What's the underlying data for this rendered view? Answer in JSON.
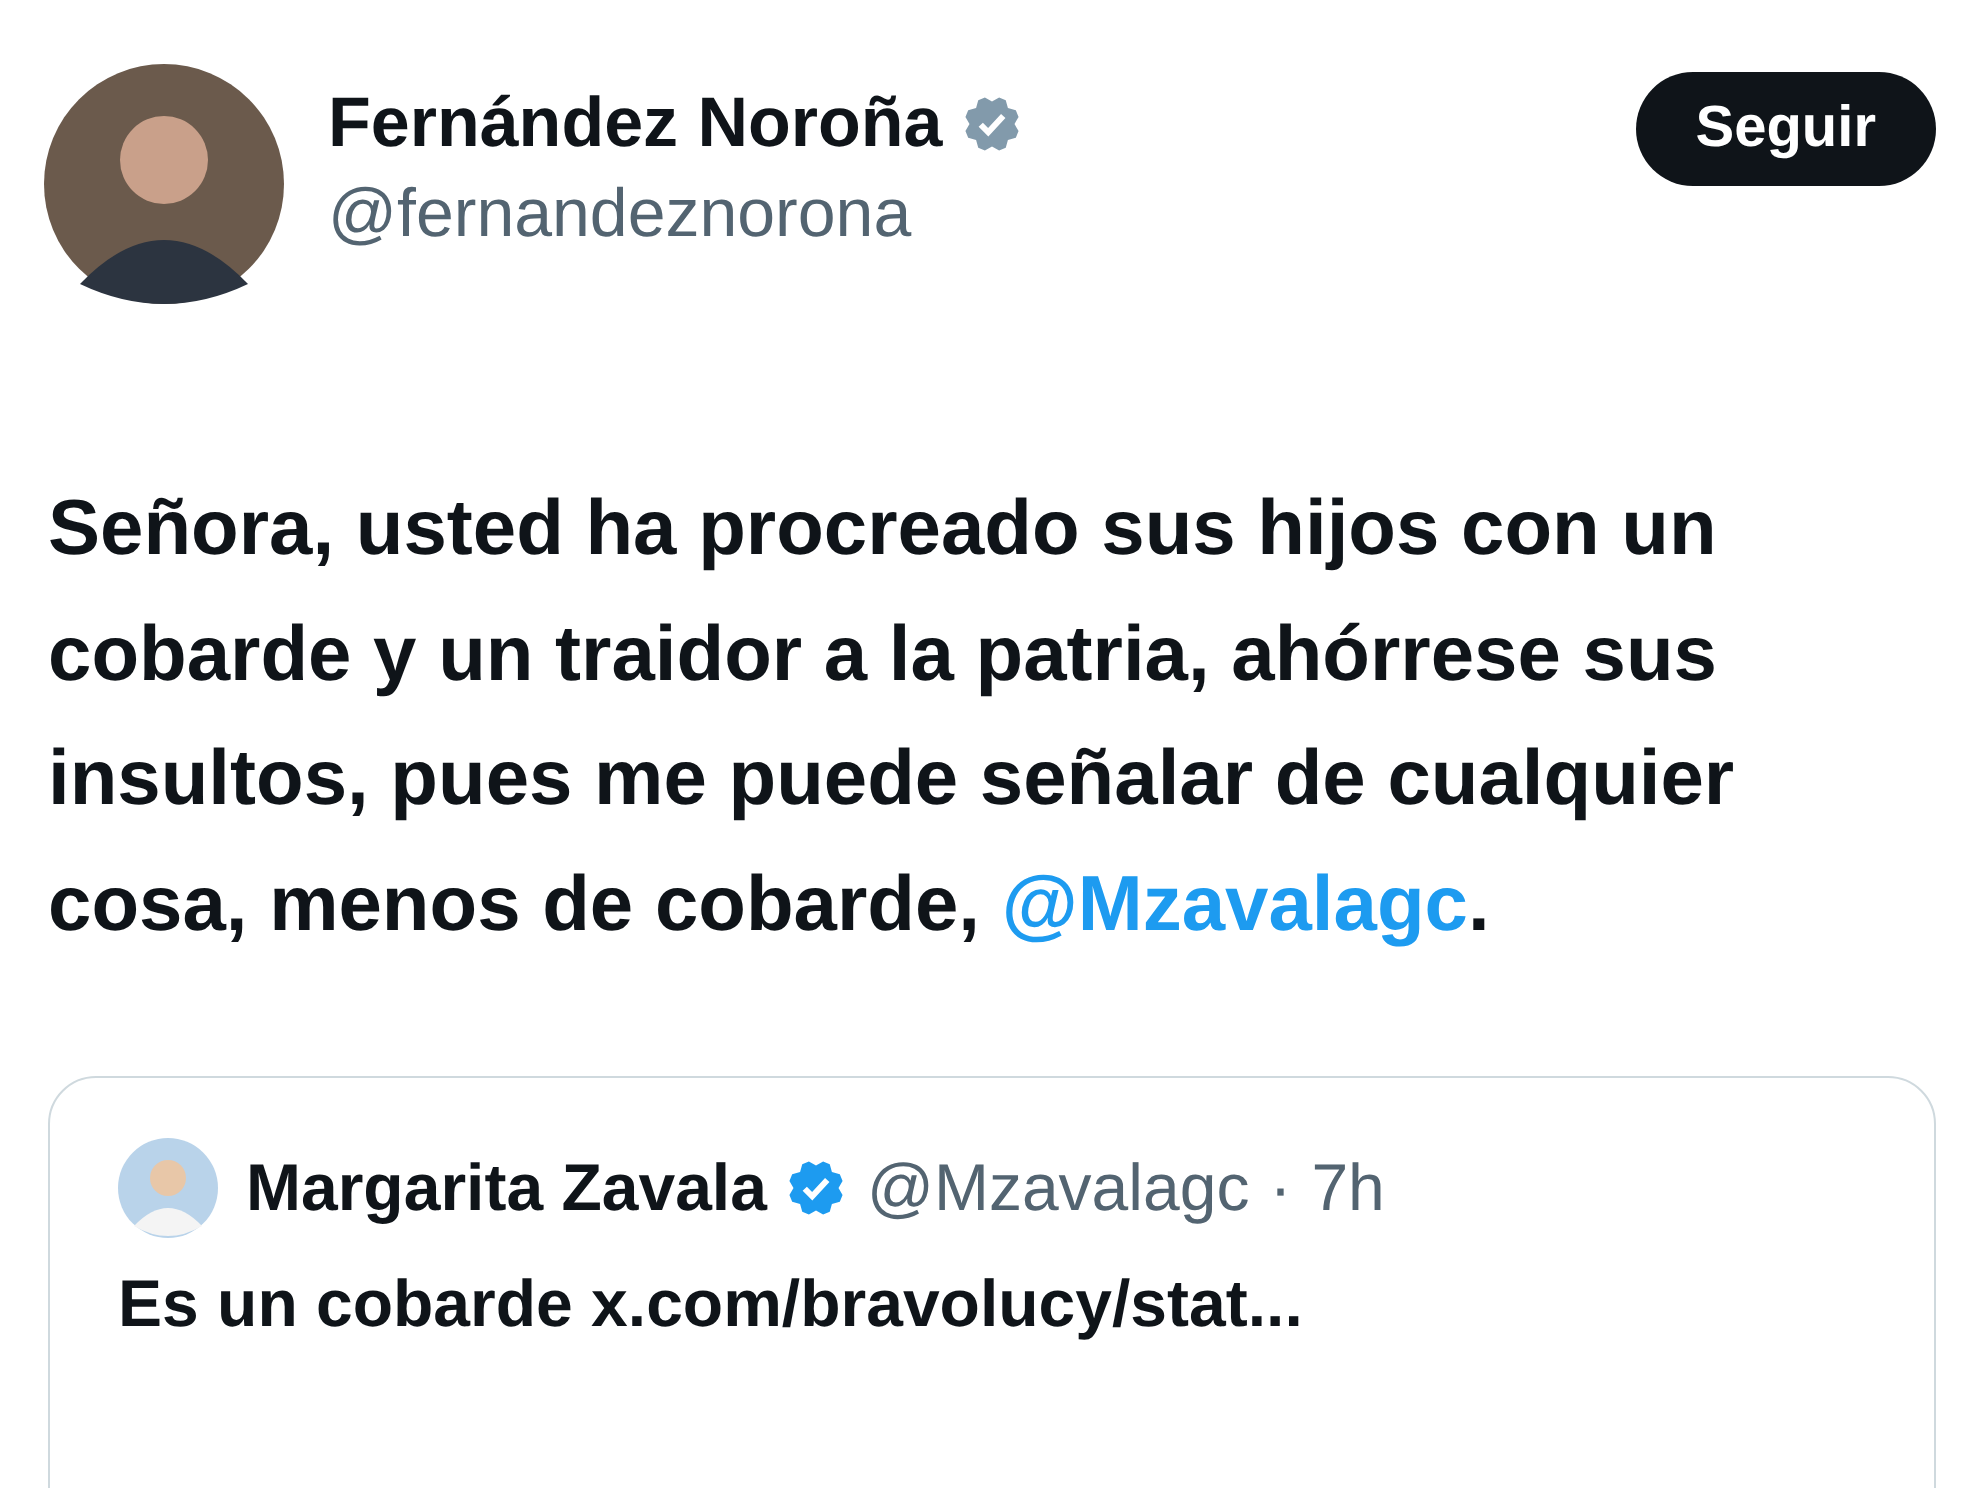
{
  "author": {
    "name": "Fernández Noroña",
    "handle": "@fernandeznorona",
    "verified": true,
    "badge": {
      "color": "#829aab"
    }
  },
  "follow_button": {
    "label": "Seguir"
  },
  "tweet_text": [
    {
      "kind": "text",
      "text": "Señora, usted ha procreado sus hijos con un cobarde y un traidor a la patria, ahórrese sus insultos, pues me puede señalar de cualquier cosa, menos de cobarde, "
    },
    {
      "kind": "mention",
      "text": "@Mzavalagc"
    },
    {
      "kind": "text",
      "text": "."
    }
  ],
  "quoted_tweet": {
    "name": "Margarita Zavala",
    "verified": true,
    "badge": {
      "color": "#1d9bf0"
    },
    "handle": "@Mzavalagc",
    "separator": "·",
    "time": "7h",
    "text": "Es un cobarde x.com/bravolucy/stat..."
  }
}
